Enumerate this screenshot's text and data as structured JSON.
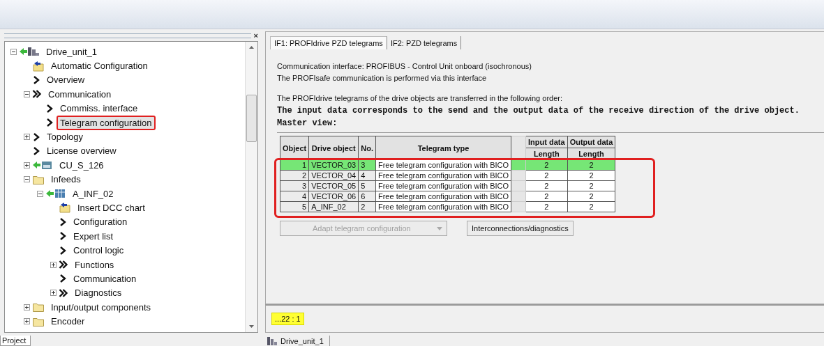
{
  "pane_close": "×",
  "project_tree": {
    "nodes": [
      {
        "label": "Drive_unit_1",
        "kind": "drive",
        "expanded": true,
        "selected": false,
        "marked": false,
        "children": [
          {
            "label": "Automatic Configuration",
            "kind": "wizard",
            "selected": false,
            "marked": false
          },
          {
            "label": "Overview",
            "kind": "arrow",
            "selected": false,
            "marked": false
          },
          {
            "label": "Communication",
            "kind": "double",
            "expanded": true,
            "selected": false,
            "marked": false,
            "children": [
              {
                "label": "Commiss. interface",
                "kind": "arrow",
                "selected": false,
                "marked": false
              },
              {
                "label": "Telegram configuration",
                "kind": "arrow",
                "selected": true,
                "marked": true
              }
            ]
          },
          {
            "label": "Topology",
            "kind": "arrow",
            "expanded": false,
            "selected": false,
            "marked": false
          },
          {
            "label": "License overview",
            "kind": "arrow",
            "selected": false,
            "marked": false
          },
          {
            "label": "CU_S_126",
            "kind": "unit",
            "expanded": false,
            "selected": false,
            "marked": false
          },
          {
            "label": "Infeeds",
            "kind": "folder",
            "expanded": true,
            "selected": false,
            "marked": false,
            "children": [
              {
                "label": "A_INF_02",
                "kind": "module",
                "expanded": true,
                "selected": false,
                "marked": false,
                "children": [
                  {
                    "label": "Insert DCC chart",
                    "kind": "wizard",
                    "selected": false,
                    "marked": false
                  },
                  {
                    "label": "Configuration",
                    "kind": "arrow",
                    "selected": false,
                    "marked": false
                  },
                  {
                    "label": "Expert list",
                    "kind": "arrow",
                    "selected": false,
                    "marked": false
                  },
                  {
                    "label": "Control logic",
                    "kind": "arrow",
                    "selected": false,
                    "marked": false
                  },
                  {
                    "label": "Functions",
                    "kind": "double",
                    "expanded": false,
                    "selected": false,
                    "marked": false
                  },
                  {
                    "label": "Communication",
                    "kind": "arrow",
                    "selected": false,
                    "marked": false
                  },
                  {
                    "label": "Diagnostics",
                    "kind": "double",
                    "expanded": false,
                    "selected": false,
                    "marked": false
                  }
                ]
              }
            ]
          },
          {
            "label": "Input/output components",
            "kind": "folder",
            "expanded": false,
            "selected": false,
            "marked": false
          },
          {
            "label": "Encoder",
            "kind": "folder",
            "expanded": false,
            "selected": false,
            "marked": false
          }
        ]
      }
    ]
  },
  "left_tab": "Project",
  "tabs": [
    {
      "label": "IF1:  PROFIdrive  PZD telegrams",
      "selected": true
    },
    {
      "label": "IF2:  PZD telegrams",
      "selected": false
    }
  ],
  "info_lines": [
    "Communication interface: PROFIBUS - Control Unit onboard (isochronous)",
    "The PROFIsafe communication is performed via this interface"
  ],
  "order_line": "The PROFIdrive telegrams of the drive objects are transferred in the following order:",
  "bold_lines": [
    "The input data corresponds to the send and the output data of the receive direction of the drive object.",
    "Master view:"
  ],
  "table": {
    "marked": true,
    "columns": [
      {
        "kind": "number",
        "label": "Object"
      },
      {
        "kind": "text",
        "label": "Drive object"
      },
      {
        "kind": "text",
        "label": "No."
      },
      {
        "kind": "field",
        "label": "Telegram type"
      },
      {
        "kind": "spacer"
      },
      {
        "kind": "grouped",
        "label": "Input data",
        "sublabel": "Length"
      },
      {
        "kind": "grouped",
        "label": "Output data",
        "sublabel": "Length"
      }
    ],
    "rows": [
      {
        "cells": [
          "1",
          "VECTOR_03",
          "3",
          "Free telegram configuration with BICO",
          "",
          "2",
          "2"
        ],
        "selected": true
      },
      {
        "cells": [
          "2",
          "VECTOR_04",
          "4",
          "Free telegram configuration with BICO",
          "",
          "2",
          "2"
        ],
        "selected": false
      },
      {
        "cells": [
          "3",
          "VECTOR_05",
          "5",
          "Free telegram configuration with BICO",
          "",
          "2",
          "2"
        ],
        "selected": false
      },
      {
        "cells": [
          "4",
          "VECTOR_06",
          "6",
          "Free telegram configuration with BICO",
          "",
          "2",
          "2"
        ],
        "selected": false
      },
      {
        "cells": [
          "5",
          "A_INF_02",
          "2",
          "Free telegram configuration with BICO",
          "",
          "2",
          "2"
        ],
        "selected": false
      }
    ]
  },
  "buttons": [
    {
      "label": "Adapt telegram configuration",
      "kind": "dropdown",
      "disabled": true
    },
    {
      "label": "Interconnections/diagnostics",
      "kind": "plain",
      "disabled": false
    }
  ],
  "status_badge": "...22 : 1",
  "window_tab": "Drive_unit_1"
}
